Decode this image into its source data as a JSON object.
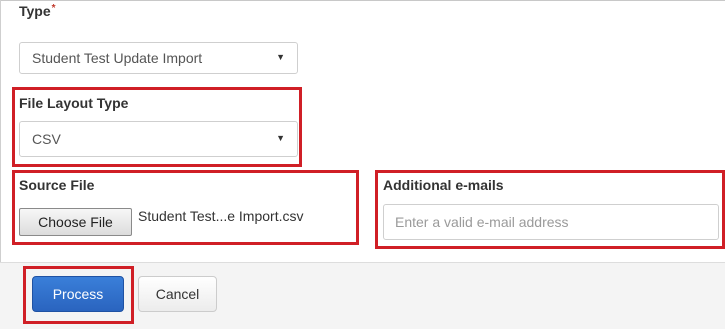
{
  "form": {
    "type": {
      "label": "Type",
      "required_mark": "*",
      "value": "Student Test Update Import"
    },
    "file_layout_type": {
      "label": "File Layout Type",
      "value": "CSV"
    },
    "source_file": {
      "label": "Source File",
      "button_label": "Choose File",
      "file_name": "Student Test...e Import.csv"
    },
    "additional_emails": {
      "label": "Additional e-mails",
      "value": "",
      "placeholder": "Enter a valid e-mail address"
    }
  },
  "actions": {
    "process_label": "Process",
    "cancel_label": "Cancel"
  },
  "icons": {
    "select_caret": "caret-down-icon"
  },
  "colors": {
    "highlight": "#d01f26",
    "primary": "#2a64bf"
  }
}
